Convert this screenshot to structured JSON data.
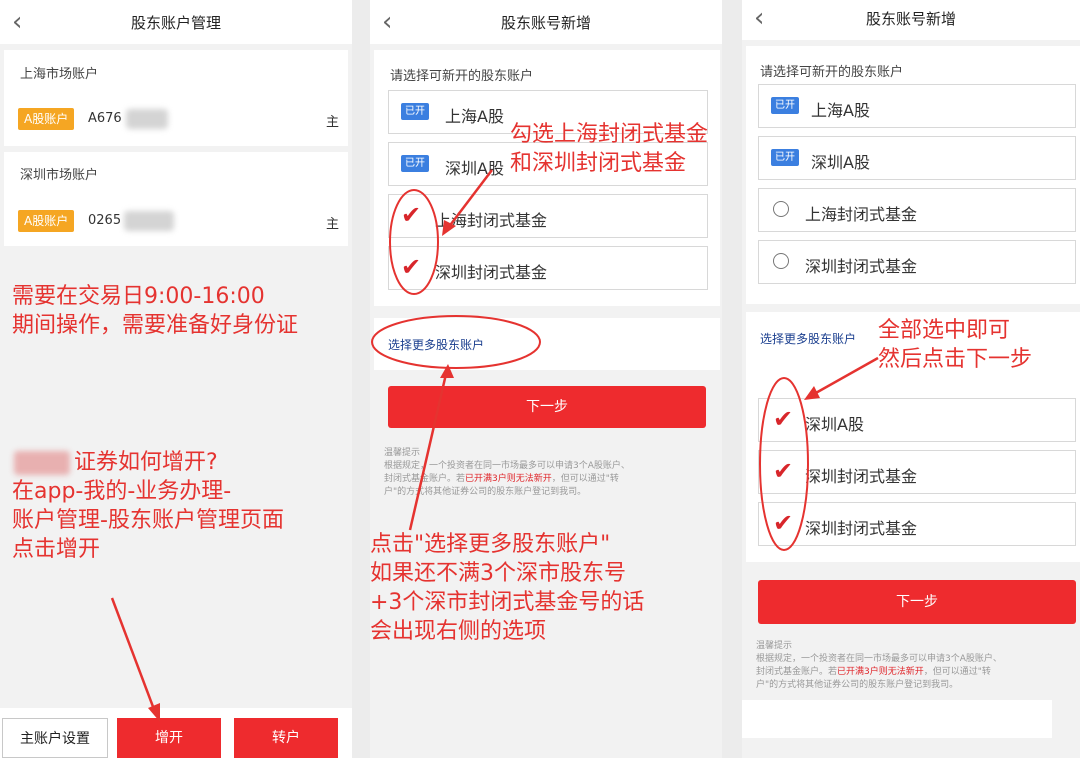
{
  "panel1": {
    "title": "股东账户管理",
    "back_icon": "chevron-left-icon",
    "shanghai_header": "上海市场账户",
    "shanghai_badge": "A股账户",
    "shanghai_account": "A676",
    "shanghai_tag": "主",
    "shenzhen_header": "深圳市场账户",
    "shenzhen_badge": "A股账户",
    "shenzhen_account": "0265",
    "shenzhen_tag": "主",
    "note1": [
      "需要在交易日9:00-16:00",
      "期间操作，需要准备好身份证"
    ],
    "note2": [
      "证券如何增开?",
      "在app-我的-业务办理-",
      "账户管理-股东账户管理页面",
      "点击增开"
    ],
    "btn_main": "主账户设置",
    "btn_add": "增开",
    "btn_transfer": "转户"
  },
  "panel2": {
    "title": "股东账号新增",
    "section_label": "请选择可新开的股东账户",
    "options": [
      {
        "badge": "已开",
        "label": "上海A股"
      },
      {
        "badge": "已开",
        "label": "深圳A股"
      },
      {
        "label": "上海封闭式基金"
      },
      {
        "label": "深圳封闭式基金"
      }
    ],
    "more_link": "选择更多股东账户",
    "next_btn": "下一步",
    "tip_title": "温馨提示",
    "tip_line1": "根据规定，一个投资者在同一市场最多可以申请3个A股账户、",
    "tip_line2_a": "封闭式基金账户。若",
    "tip_line2_b": "已开满3户则无法新开",
    "tip_line2_c": "，但可以通过\"转",
    "tip_line3": "户\"的方式将其他证券公司的股东账户登记到我司。",
    "note_top": [
      "勾选上海封闭式基金",
      "和深圳封闭式基金"
    ],
    "note_bottom": [
      "点击\"选择更多股东账户\"",
      "如果还不满3个深市股东号",
      "+3个深市封闭式基金号的话",
      "会出现右侧的选项"
    ]
  },
  "panel3": {
    "title": "股东账号新增",
    "section_label": "请选择可新开的股东账户",
    "options": [
      {
        "badge": "已开",
        "label": "上海A股"
      },
      {
        "badge": "已开",
        "label": "深圳A股"
      },
      {
        "label": "上海封闭式基金"
      },
      {
        "label": "深圳封闭式基金"
      }
    ],
    "more_link": "选择更多股东账户",
    "more_options": [
      {
        "label": "深圳A股"
      },
      {
        "label": "深圳封闭式基金"
      },
      {
        "label": "深圳封闭式基金"
      }
    ],
    "next_btn": "下一步",
    "tip_title": "温馨提示",
    "tip_line1": "根据规定，一个投资者在同一市场最多可以申请3个A股账户、",
    "tip_line2_a": "封闭式基金账户。若",
    "tip_line2_b": "已开满3户则无法新开",
    "tip_line2_c": "，但可以通过\"转",
    "tip_line3": "户\"的方式将其他证券公司的股东账户登记到我司。",
    "note": [
      "全部选中即可",
      "然后点击下一步"
    ]
  },
  "colors": {
    "accent_red": "#ee2b2e",
    "annotation_red": "#e53330",
    "badge_orange": "#f5a623",
    "badge_blue": "#3b7fe0",
    "link_blue": "#1b3f8f"
  }
}
